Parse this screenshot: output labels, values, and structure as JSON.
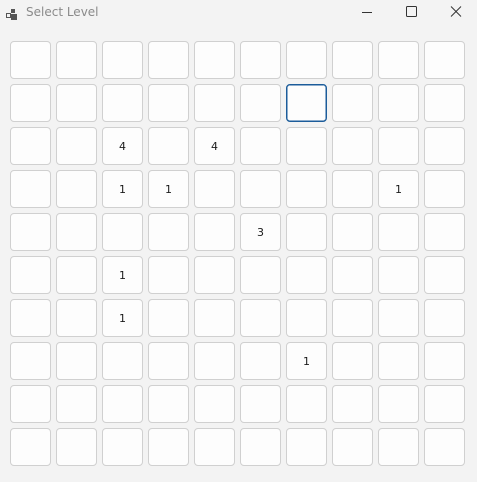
{
  "window": {
    "title": "Select Level",
    "icon": "app-icon",
    "controls": [
      "minimize-icon",
      "maximize-icon",
      "close-icon"
    ]
  },
  "grid": {
    "rows": 10,
    "cols": 10,
    "focused_cell": [
      1,
      6
    ],
    "cells": [
      [
        "",
        "",
        "",
        "",
        "",
        "",
        "",
        "",
        "",
        ""
      ],
      [
        "",
        "",
        "",
        "",
        "",
        "",
        "",
        "",
        "",
        ""
      ],
      [
        "",
        "",
        "4",
        "",
        "4",
        "",
        "",
        "",
        "",
        ""
      ],
      [
        "",
        "",
        "1",
        "1",
        "",
        "",
        "",
        "",
        "1",
        ""
      ],
      [
        "",
        "",
        "",
        "",
        "",
        "3",
        "",
        "",
        "",
        ""
      ],
      [
        "",
        "",
        "1",
        "",
        "",
        "",
        "",
        "",
        "",
        ""
      ],
      [
        "",
        "",
        "1",
        "",
        "",
        "",
        "",
        "",
        "",
        ""
      ],
      [
        "",
        "",
        "",
        "",
        "",
        "",
        "1",
        "",
        "",
        ""
      ],
      [
        "",
        "",
        "",
        "",
        "",
        "",
        "",
        "",
        "",
        ""
      ],
      [
        "",
        "",
        "",
        "",
        "",
        "",
        "",
        "",
        "",
        ""
      ]
    ]
  },
  "colors": {
    "background": "#f3f3f3",
    "cell_background": "#fdfdfd",
    "cell_border": "#d0d0d0",
    "focus_border": "#1c5c9a",
    "title_text": "#8a8a8a"
  }
}
